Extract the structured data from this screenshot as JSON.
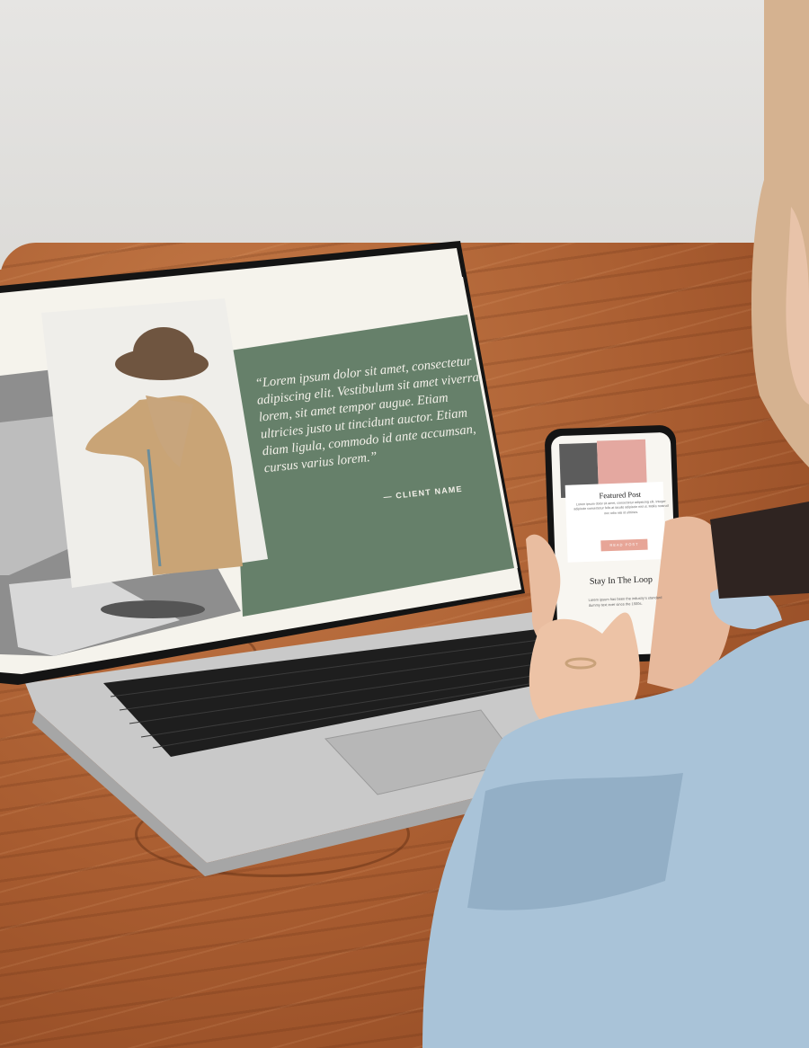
{
  "desktop_site": {
    "testimonial_quote": "“Lorem ipsum dolor sit amet, consectetur adipiscing elit. Vestibulum sit amet viverra lorem, sit amet tempor augue. Etiam ultricies justo ut tincidunt auctor. Etiam diam ligula, commodo id ante accumsan, cursus varius lorem.”",
    "client_name": "— CLIENT NAME",
    "colors": {
      "green_panel": "#66806a",
      "cream_bar": "#f5f3ec",
      "photo_bg": "#efeeea"
    }
  },
  "mobile_site": {
    "featured_title": "Featured Post",
    "featured_body": "Lorem ipsum dolor sit amet, consectetur adipiscing elit. Integer adipiscin consectetur felis at iaculis adipiscin nisl ut. Mollis nostrud nec odio nisi id ultricies.",
    "read_button": "READ POST",
    "loop_title": "Stay In The Loop",
    "loop_body": "Lorem ipsum has been the industry's standard dummy text ever since the 1500s.",
    "colors": {
      "pink_button": "#e7a597"
    }
  }
}
